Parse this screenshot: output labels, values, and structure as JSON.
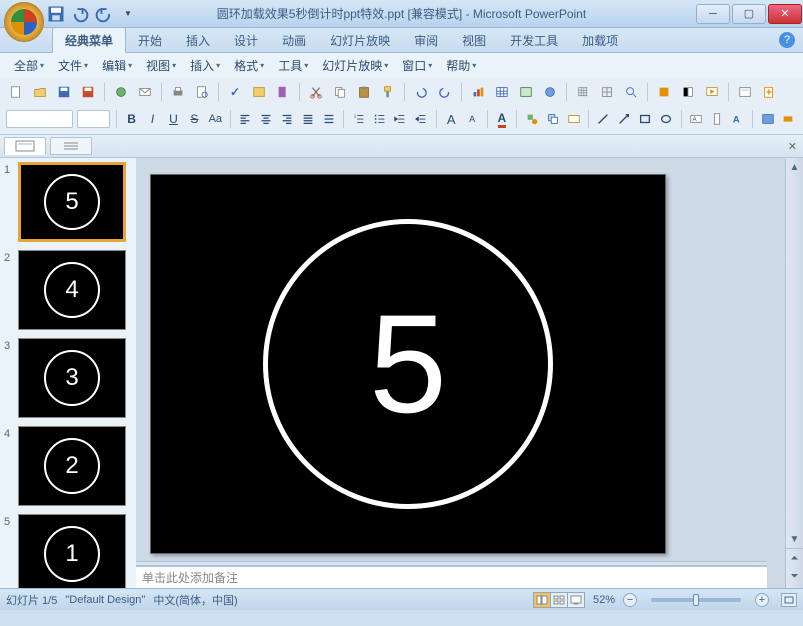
{
  "title": "圆环加载效果5秒倒计时ppt特效.ppt [兼容模式] - Microsoft PowerPoint",
  "tabs": [
    "经典菜单",
    "开始",
    "插入",
    "设计",
    "动画",
    "幻灯片放映",
    "审阅",
    "视图",
    "开发工具",
    "加载项"
  ],
  "active_tab": 0,
  "classic_menu": [
    "全部",
    "文件",
    "编辑",
    "视图",
    "插入",
    "格式",
    "工具",
    "幻灯片放映",
    "窗口",
    "帮助"
  ],
  "slides": [
    {
      "num": "1",
      "label": "5"
    },
    {
      "num": "2",
      "label": "4"
    },
    {
      "num": "3",
      "label": "3"
    },
    {
      "num": "4",
      "label": "2"
    },
    {
      "num": "5",
      "label": "1"
    }
  ],
  "current_slide_number": "5",
  "notes_placeholder": "单击此处添加备注",
  "status": {
    "slide": "幻灯片 1/5",
    "design": "\"Default Design\"",
    "lang": "中文(简体，中国)",
    "zoom": "52%"
  }
}
